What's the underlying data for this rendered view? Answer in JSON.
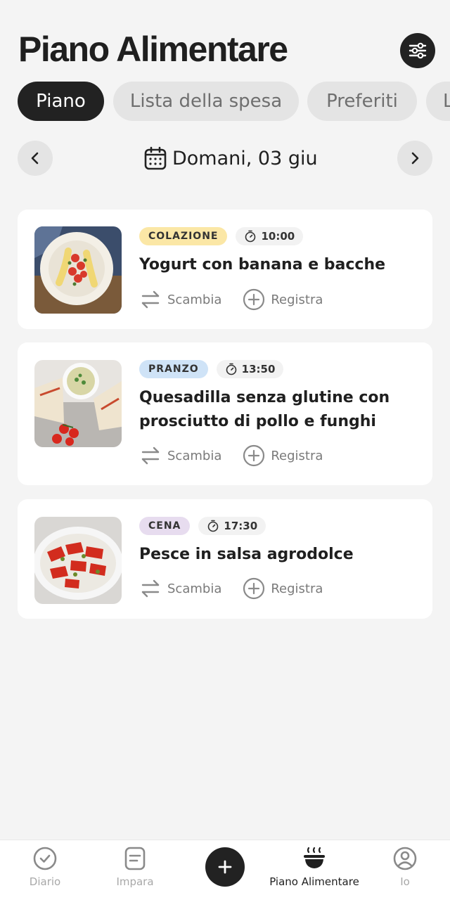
{
  "header": {
    "title": "Piano Alimentare",
    "filter_icon": "sliders-icon"
  },
  "tabs": [
    {
      "label": "Piano",
      "active": true
    },
    {
      "label": "Lista della spesa",
      "active": false
    },
    {
      "label": "Preferiti",
      "active": false
    },
    {
      "label": "L",
      "active": false
    }
  ],
  "date": {
    "label": "Domani, 03 giu",
    "icon": "calendar-icon"
  },
  "meals": [
    {
      "badge": "COLAZIONE",
      "badge_color": "#fbe7a6",
      "time": "10:00",
      "title": "Yogurt con banana e bacche",
      "swap": "Scambia",
      "log": "Registra"
    },
    {
      "badge": "PRANZO",
      "badge_color": "#cfe3f7",
      "time": "13:50",
      "title": "Quesadilla senza glutine con prosciutto di pollo e funghi",
      "swap": "Scambia",
      "log": "Registra"
    },
    {
      "badge": "CENA",
      "badge_color": "#e7dcef",
      "time": "17:30",
      "title": "Pesce in salsa agrodolce",
      "swap": "Scambia",
      "log": "Registra"
    }
  ],
  "nav": [
    {
      "label": "Diario",
      "icon": "check-circle-icon",
      "active": false
    },
    {
      "label": "Impara",
      "icon": "note-icon",
      "active": false
    },
    {
      "label": "Piano Alimentare",
      "icon": "bowl-icon",
      "active": true
    },
    {
      "label": "Io",
      "icon": "user-circle-icon",
      "active": false
    }
  ],
  "colors": {
    "accent": "#222222",
    "background": "#f4f4f4"
  }
}
